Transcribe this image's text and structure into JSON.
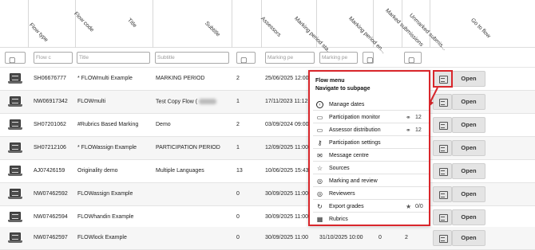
{
  "columns": [
    "Flow type",
    "Flow code",
    "Title",
    "Subtitle",
    "Assessors",
    "Marking period sta...",
    "Marking period en...",
    "Marked submissions",
    "Unmarked submis...",
    "Go to flow"
  ],
  "filters": {
    "flow_code": "Flow c",
    "title": "Title",
    "subtitle": "Subtitle",
    "marking_start": "Marking pe",
    "marking_end": "Marking pe"
  },
  "rows": [
    {
      "code": "SH06676777",
      "title": "* FLOWmulti Example",
      "subtitle": "MARKING PERIOD",
      "assessors": "2",
      "start": "25/06/2025 12:00"
    },
    {
      "code": "NW06917342",
      "title": "FLOWmulti",
      "subtitle": "Test Copy Flow (",
      "assessors": "1",
      "start": "17/11/2023 11:12"
    },
    {
      "code": "SH07201062",
      "title": "#Rubrics Based Marking",
      "subtitle": "Demo",
      "assessors": "2",
      "start": "03/09/2024 09:00"
    },
    {
      "code": "SH07212106",
      "title": "* FLOWassign Example",
      "subtitle": "PARTICIPATION PERIOD",
      "assessors": "1",
      "start": "12/09/2025 11:00"
    },
    {
      "code": "AJ07426159",
      "title": "Originality demo",
      "subtitle": "Multiple Languages",
      "assessors": "13",
      "start": "10/06/2025 15:43"
    },
    {
      "code": "NW07462592",
      "title": "FLOWassign Example",
      "subtitle": "",
      "assessors": "0",
      "start": "30/09/2025 11:00"
    },
    {
      "code": "NW07462594",
      "title": "FLOWhandin Example",
      "subtitle": "",
      "assessors": "0",
      "start": "30/09/2025 11:00"
    },
    {
      "code": "NW07462597",
      "title": "FLOWlock Example",
      "subtitle": "",
      "assessors": "0",
      "start": "30/09/2025 11:00",
      "end": "31/10/2025 10:00",
      "marked": "0",
      "unmarked": "2"
    }
  ],
  "open_label": "Open",
  "flow_menu": {
    "title": "Flow menu",
    "subtitle": "Navigate to subpage",
    "items": [
      {
        "label": "Manage dates",
        "icon": "clock-icon"
      },
      {
        "label": "Participation monitor",
        "icon": "monitor-icon",
        "extra_icon": "participants-icon",
        "value": "12"
      },
      {
        "label": "Assessor distribution",
        "icon": "chat-icon",
        "extra_icon": "assessors-icon",
        "value": "12"
      },
      {
        "label": "Participation settings",
        "icon": "key-icon"
      },
      {
        "label": "Message centre",
        "icon": "envelope-icon"
      },
      {
        "label": "Sources",
        "icon": "star-icon"
      },
      {
        "label": "Marking and review",
        "icon": "marking-icon"
      },
      {
        "label": "Reviewers",
        "icon": "reviewers-icon"
      },
      {
        "label": "Export grades",
        "icon": "export-icon",
        "extra_icon": "star-filled-icon",
        "value": "0/0"
      },
      {
        "label": "Rubrics",
        "icon": "grid-icon"
      }
    ]
  },
  "colors": {
    "highlight": "#d9262b",
    "button": "#e4e4e4",
    "alt_row": "#f6f6f6"
  }
}
